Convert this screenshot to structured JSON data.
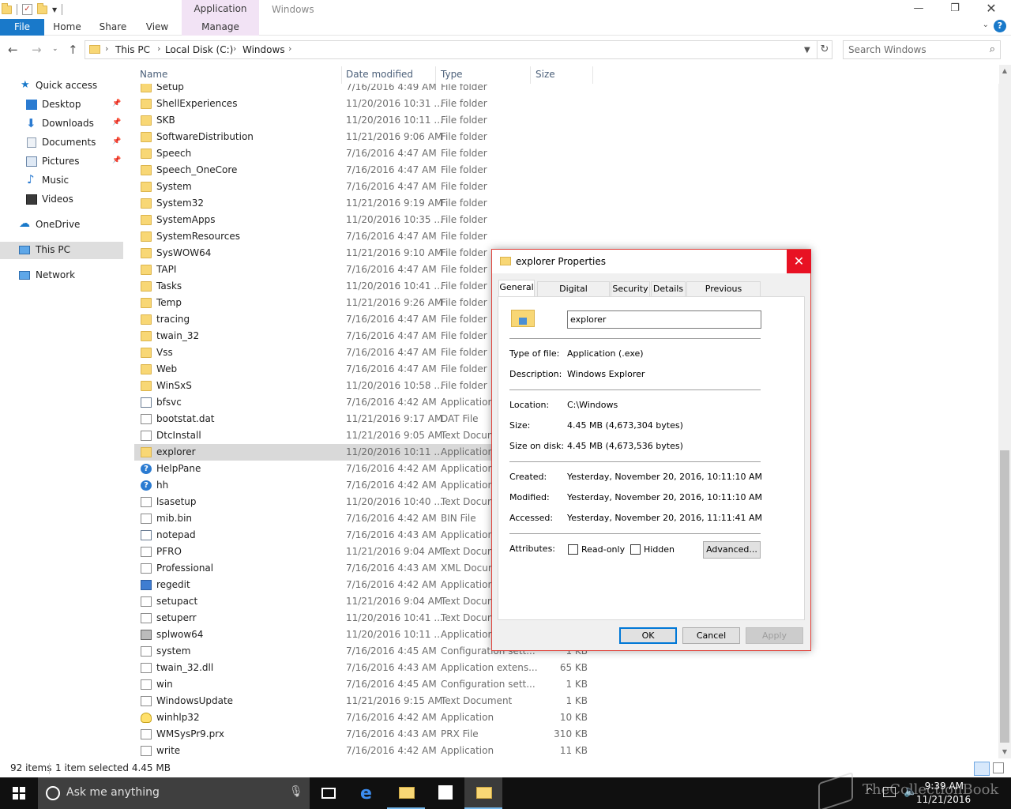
{
  "window": {
    "title": "Windows",
    "context_tab_title": "Application Tools",
    "minimize_icon": "minimize-icon",
    "maximize_icon": "restore-icon",
    "close_icon": "close-icon"
  },
  "ribbon": {
    "tabs": [
      "File",
      "Home",
      "Share",
      "View",
      "Manage"
    ],
    "file_color": "#1979ca",
    "context_color": "#f2e3f5"
  },
  "address": {
    "crumbs": [
      "This PC",
      "Local Disk (C:)",
      "Windows"
    ],
    "search_placeholder": "Search Windows"
  },
  "nav": {
    "items": [
      {
        "label": "Quick access",
        "icon": "star-icon"
      },
      {
        "label": "Desktop",
        "icon": "desktop-icon",
        "pinned": true
      },
      {
        "label": "Downloads",
        "icon": "download-icon",
        "pinned": true
      },
      {
        "label": "Documents",
        "icon": "documents-icon",
        "pinned": true
      },
      {
        "label": "Pictures",
        "icon": "pictures-icon",
        "pinned": true
      },
      {
        "label": "Music",
        "icon": "music-icon"
      },
      {
        "label": "Videos",
        "icon": "videos-icon"
      },
      {
        "label": "OneDrive",
        "icon": "cloud-icon"
      },
      {
        "label": "This PC",
        "icon": "computer-icon",
        "selected": true
      },
      {
        "label": "Network",
        "icon": "network-icon"
      }
    ]
  },
  "columns": {
    "name": "Name",
    "date": "Date modified",
    "type": "Type",
    "size": "Size"
  },
  "files": [
    {
      "name": "Setup",
      "date": "7/16/2016 4:49 AM",
      "type": "File folder",
      "size": "",
      "icon": "folder"
    },
    {
      "name": "ShellExperiences",
      "date": "11/20/2016 10:31 ...",
      "type": "File folder",
      "size": "",
      "icon": "folder"
    },
    {
      "name": "SKB",
      "date": "11/20/2016 10:11 ...",
      "type": "File folder",
      "size": "",
      "icon": "folder"
    },
    {
      "name": "SoftwareDistribution",
      "date": "11/21/2016 9:06 AM",
      "type": "File folder",
      "size": "",
      "icon": "folder"
    },
    {
      "name": "Speech",
      "date": "7/16/2016 4:47 AM",
      "type": "File folder",
      "size": "",
      "icon": "folder"
    },
    {
      "name": "Speech_OneCore",
      "date": "7/16/2016 4:47 AM",
      "type": "File folder",
      "size": "",
      "icon": "folder"
    },
    {
      "name": "System",
      "date": "7/16/2016 4:47 AM",
      "type": "File folder",
      "size": "",
      "icon": "folder"
    },
    {
      "name": "System32",
      "date": "11/21/2016 9:19 AM",
      "type": "File folder",
      "size": "",
      "icon": "folder"
    },
    {
      "name": "SystemApps",
      "date": "11/20/2016 10:35 ...",
      "type": "File folder",
      "size": "",
      "icon": "folder"
    },
    {
      "name": "SystemResources",
      "date": "7/16/2016 4:47 AM",
      "type": "File folder",
      "size": "",
      "icon": "folder"
    },
    {
      "name": "SysWOW64",
      "date": "11/21/2016 9:10 AM",
      "type": "File folder",
      "size": "",
      "icon": "folder"
    },
    {
      "name": "TAPI",
      "date": "7/16/2016 4:47 AM",
      "type": "File folder",
      "size": "",
      "icon": "folder"
    },
    {
      "name": "Tasks",
      "date": "11/20/2016 10:41 ...",
      "type": "File folder",
      "size": "",
      "icon": "folder"
    },
    {
      "name": "Temp",
      "date": "11/21/2016 9:26 AM",
      "type": "File folder",
      "size": "",
      "icon": "folder"
    },
    {
      "name": "tracing",
      "date": "7/16/2016 4:47 AM",
      "type": "File folder",
      "size": "",
      "icon": "folder"
    },
    {
      "name": "twain_32",
      "date": "7/16/2016 4:47 AM",
      "type": "File folder",
      "size": "",
      "icon": "folder"
    },
    {
      "name": "Vss",
      "date": "7/16/2016 4:47 AM",
      "type": "File folder",
      "size": "",
      "icon": "folder"
    },
    {
      "name": "Web",
      "date": "7/16/2016 4:47 AM",
      "type": "File folder",
      "size": "",
      "icon": "folder"
    },
    {
      "name": "WinSxS",
      "date": "11/20/2016 10:58 ...",
      "type": "File folder",
      "size": "",
      "icon": "folder"
    },
    {
      "name": "bfsvc",
      "date": "7/16/2016 4:42 AM",
      "type": "Application",
      "size": "",
      "icon": "app"
    },
    {
      "name": "bootstat.dat",
      "date": "11/21/2016 9:17 AM",
      "type": "DAT File",
      "size": "",
      "icon": "doc"
    },
    {
      "name": "DtcInstall",
      "date": "11/21/2016 9:05 AM",
      "type": "Text Docum",
      "size": "",
      "icon": "doc"
    },
    {
      "name": "explorer",
      "date": "11/20/2016 10:11 ...",
      "type": "Application",
      "size": "",
      "icon": "explorer-icon",
      "selected": true
    },
    {
      "name": "HelpPane",
      "date": "7/16/2016 4:42 AM",
      "type": "Application",
      "size": "",
      "icon": "help"
    },
    {
      "name": "hh",
      "date": "7/16/2016 4:42 AM",
      "type": "Application",
      "size": "",
      "icon": "help"
    },
    {
      "name": "lsasetup",
      "date": "11/20/2016 10:40 ...",
      "type": "Text Docum",
      "size": "",
      "icon": "doc"
    },
    {
      "name": "mib.bin",
      "date": "7/16/2016 4:42 AM",
      "type": "BIN File",
      "size": "",
      "icon": "doc"
    },
    {
      "name": "notepad",
      "date": "7/16/2016 4:43 AM",
      "type": "Application",
      "size": "",
      "icon": "app"
    },
    {
      "name": "PFRO",
      "date": "11/21/2016 9:04 AM",
      "type": "Text Docum",
      "size": "",
      "icon": "doc"
    },
    {
      "name": "Professional",
      "date": "7/16/2016 4:43 AM",
      "type": "XML Docum",
      "size": "",
      "icon": "doc"
    },
    {
      "name": "regedit",
      "date": "7/16/2016 4:42 AM",
      "type": "Application",
      "size": "",
      "icon": "regedit"
    },
    {
      "name": "setupact",
      "date": "11/21/2016 9:04 AM",
      "type": "Text Docum",
      "size": "",
      "icon": "doc"
    },
    {
      "name": "setuperr",
      "date": "11/20/2016 10:41 ...",
      "type": "Text Docum",
      "size": "",
      "icon": "doc"
    },
    {
      "name": "splwow64",
      "date": "11/20/2016 10:11 ...",
      "type": "Application",
      "size": "",
      "icon": "printer"
    },
    {
      "name": "system",
      "date": "7/16/2016 4:45 AM",
      "type": "Configuration sett...",
      "size": "1 KB",
      "icon": "doc"
    },
    {
      "name": "twain_32.dll",
      "date": "7/16/2016 4:43 AM",
      "type": "Application extens...",
      "size": "65 KB",
      "icon": "doc"
    },
    {
      "name": "win",
      "date": "7/16/2016 4:45 AM",
      "type": "Configuration sett...",
      "size": "1 KB",
      "icon": "doc"
    },
    {
      "name": "WindowsUpdate",
      "date": "11/21/2016 9:15 AM",
      "type": "Text Document",
      "size": "1 KB",
      "icon": "doc"
    },
    {
      "name": "winhlp32",
      "date": "7/16/2016 4:42 AM",
      "type": "Application",
      "size": "10 KB",
      "icon": "bulb"
    },
    {
      "name": "WMSysPr9.prx",
      "date": "7/16/2016 4:43 AM",
      "type": "PRX File",
      "size": "310 KB",
      "icon": "doc"
    },
    {
      "name": "write",
      "date": "7/16/2016 4:42 AM",
      "type": "Application",
      "size": "11 KB",
      "icon": "doc"
    }
  ],
  "status": {
    "count": "92 items",
    "selected": "1 item selected  4.45 MB"
  },
  "dialog": {
    "title": "explorer Properties",
    "tabs": [
      "General",
      "Digital Signatures",
      "Security",
      "Details",
      "Previous Versions"
    ],
    "filename": "explorer",
    "labels": {
      "type": "Type of file:",
      "description": "Description:",
      "location": "Location:",
      "size": "Size:",
      "size_on_disk": "Size on disk:",
      "created": "Created:",
      "modified": "Modified:",
      "accessed": "Accessed:",
      "attributes": "Attributes:"
    },
    "values": {
      "type": "Application (.exe)",
      "description": "Windows Explorer",
      "location": "C:\\Windows",
      "size": "4.45 MB (4,673,304 bytes)",
      "size_on_disk": "4.45 MB (4,673,536 bytes)",
      "created": "Yesterday, November 20, 2016, 10:11:10 AM",
      "modified": "Yesterday, November 20, 2016, 10:11:10 AM",
      "accessed": "Yesterday, November 20, 2016, 11:11:41 AM"
    },
    "readonly_label": "Read-only",
    "hidden_label": "Hidden",
    "readonly_checked": false,
    "hidden_checked": false,
    "advanced_label": "Advanced...",
    "ok_label": "OK",
    "cancel_label": "Cancel",
    "apply_label": "Apply"
  },
  "taskbar": {
    "search_placeholder": "Ask me anything",
    "time": "9:39 AM",
    "date": "11/21/2016",
    "watermark": "TheCollectionBook"
  }
}
